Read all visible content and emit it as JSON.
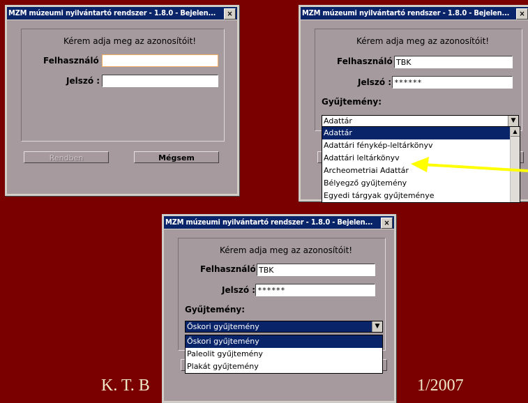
{
  "colors": {
    "background": "#7a0000",
    "titlebar": "#0a246a",
    "arrow": "#ffff00"
  },
  "window_title": "MZM múzeumi nyilvántartó rendszer -  1.8.0 - Bejelen...",
  "close_glyph": "×",
  "prompt": "Kérem adja meg az azonosítóit!",
  "user_label": "Felhasználó :",
  "password_label": "Jelszó :",
  "collection_label": "Gyűjtemény:",
  "user_value": "TBK",
  "password_value": "******",
  "ok_button": "Rendben",
  "cancel_button": "Mégsem",
  "dialog2": {
    "selected": "Adattár",
    "options": [
      "Adattár",
      "Adattári fénykép-leltárkönyv",
      "Adattári leltárkönyv",
      "Archeometriai Adattár",
      "Bélyegző gyűjtemény",
      "Egyedi tárgyak gyűjteménye"
    ]
  },
  "dialog3": {
    "selected": "Őskori gyűjtemény",
    "options": [
      "Őskori gyűjtemény",
      "Paleolit gyűjtemény",
      "Plakát gyűjtemény"
    ]
  },
  "footer_left": "K. T. B",
  "footer_right": "1/2007"
}
